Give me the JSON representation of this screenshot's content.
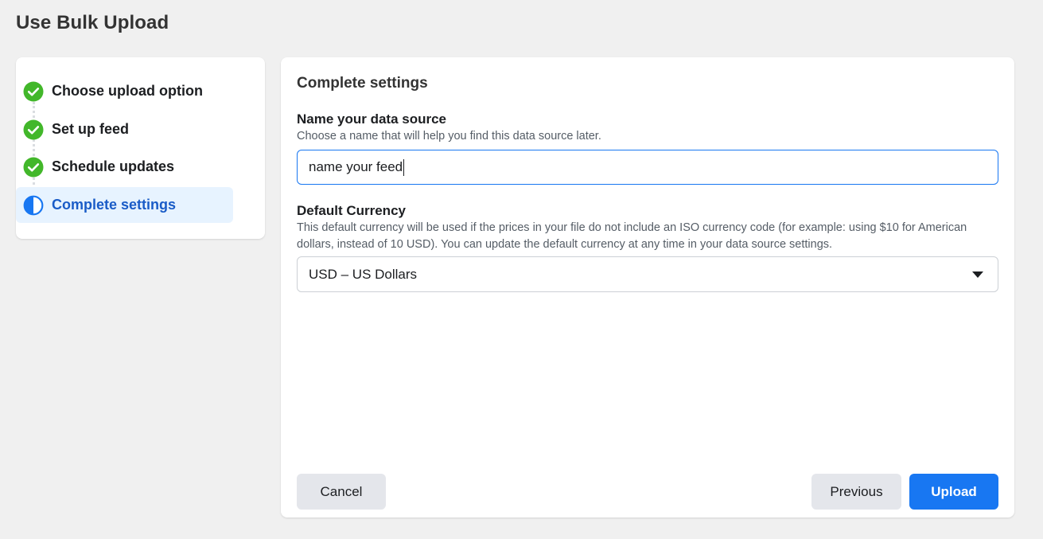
{
  "page": {
    "title": "Use Bulk Upload"
  },
  "stepper": {
    "steps": [
      {
        "label": "Choose upload option",
        "status": "complete",
        "icon": "check-circle-icon"
      },
      {
        "label": "Set up feed",
        "status": "complete",
        "icon": "check-circle-icon"
      },
      {
        "label": "Schedule updates",
        "status": "complete",
        "icon": "check-circle-icon"
      },
      {
        "label": "Complete settings",
        "status": "in-progress",
        "icon": "half-circle-icon"
      }
    ]
  },
  "panel": {
    "title": "Complete settings",
    "name_field": {
      "label": "Name your data source",
      "help": "Choose a name that will help you find this data source later.",
      "value": "name your feed"
    },
    "currency_field": {
      "label": "Default Currency",
      "help": "This default currency will be used if the prices in your file do not include an ISO currency code (for example: using $10 for American dollars, instead of 10 USD). You can update the default currency at any time in your data source settings.",
      "selected": "USD – US Dollars"
    },
    "buttons": {
      "cancel": "Cancel",
      "previous": "Previous",
      "upload": "Upload"
    }
  },
  "colors": {
    "accent": "#1877f2",
    "success": "#42b72a",
    "active_bg": "#e7f3ff",
    "active_text": "#1a5cc7"
  }
}
